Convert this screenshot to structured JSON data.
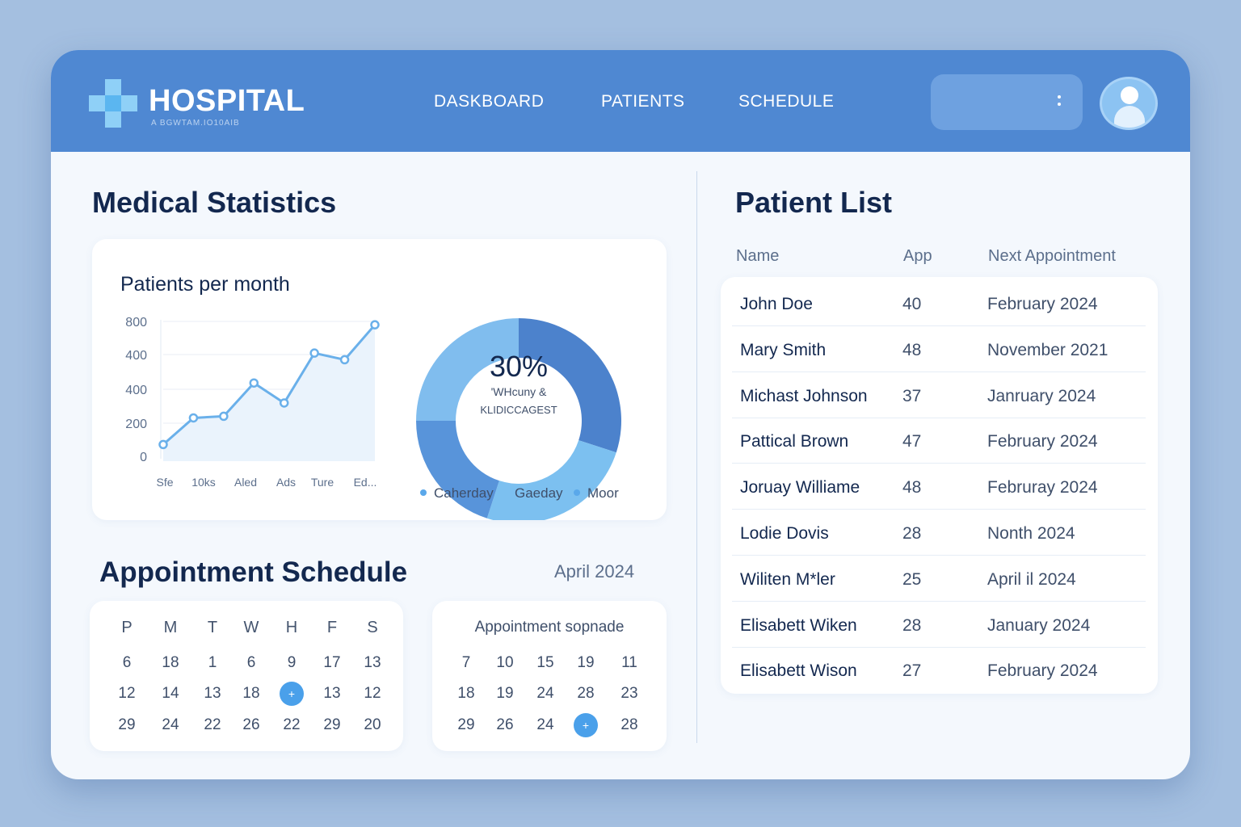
{
  "header": {
    "title": "HOSPITAL",
    "subtitle": "A BGWTAM.IO10AIB",
    "nav": [
      "DASKBOARD",
      "PATIENTS",
      "SCHEDULE"
    ],
    "accent_color": "#4f88d2",
    "logo_icon": "medical-cross-icon",
    "menu_icon": "kebab-menu-icon",
    "avatar_icon": "user-avatar-icon"
  },
  "stats": {
    "title": "Medical Statistics"
  },
  "chart_data": [
    {
      "type": "line",
      "title": "Patients per month",
      "categories": [
        "Sfe",
        "10ks",
        "Aled",
        "Ads",
        "Ture",
        "Ed..."
      ],
      "y_ticks": [
        "800",
        "400",
        "400",
        "200",
        "0"
      ],
      "series": [
        {
          "values": [
            100,
            260,
            270,
            470,
            350,
            650,
            610,
            820
          ]
        }
      ],
      "ylim": [
        0,
        850
      ],
      "grid": true,
      "color": "#6ab0ea"
    },
    {
      "type": "pie",
      "variant": "donut",
      "center_value": "30%",
      "center_label": [
        "'WHcuny &",
        "KLIDICCAGEST"
      ],
      "legend": [
        "Caherday",
        "Gaeday",
        "Moor"
      ],
      "legend_placement": "bottom",
      "slices": [
        {
          "value": 30,
          "color": "#4c82cc"
        },
        {
          "value": 25,
          "color": "#7cc0f0"
        },
        {
          "value": 20,
          "color": "#5894da"
        },
        {
          "value": 25,
          "color": "#80bdee"
        }
      ]
    }
  ],
  "schedule": {
    "title": "Appointment Schedule",
    "month": "April 2024",
    "calendar_a": {
      "weekdays": [
        "P",
        "M",
        "T",
        "W",
        "H",
        "F",
        "S"
      ],
      "rows": [
        [
          "6",
          "18",
          "1",
          "6",
          "9",
          "17",
          "13"
        ],
        [
          "12",
          "14",
          "13",
          "18",
          "+",
          "13",
          "12"
        ],
        [
          "29",
          "24",
          "22",
          "26",
          "22",
          "29",
          "20"
        ]
      ],
      "selected": "+"
    },
    "calendar_b": {
      "title": "Appointment sopnade",
      "rows": [
        [
          "7",
          "10",
          "15",
          "19",
          "11"
        ],
        [
          "18",
          "19",
          "24",
          "28",
          "23"
        ],
        [
          "29",
          "26",
          "24",
          "+",
          "28"
        ]
      ],
      "selected": "+"
    }
  },
  "patients": {
    "title": "Patient List",
    "columns": [
      "Name",
      "App",
      "Next Appointment"
    ],
    "rows": [
      {
        "name": "John Doe",
        "age": "40",
        "date": "February 2024"
      },
      {
        "name": "Mary Smith",
        "age": "48",
        "date": "November 2021"
      },
      {
        "name": "Michast Johnson",
        "age": "37",
        "date": "Janruary 2024"
      },
      {
        "name": "Pattical Brown",
        "age": "47",
        "date": "February 2024"
      },
      {
        "name": "Joruay Williame",
        "age": "48",
        "date": "Februray 2024"
      },
      {
        "name": "Lodie Dovis",
        "age": "28",
        "date": "Nonth 2024"
      },
      {
        "name": "Wiliten M*ler",
        "age": "25",
        "date": "April il 2024"
      },
      {
        "name": "Elisabett Wiken",
        "age": "28",
        "date": "January 2024"
      },
      {
        "name": "Elisabett Wison",
        "age": "27",
        "date": "February 2024"
      }
    ]
  }
}
